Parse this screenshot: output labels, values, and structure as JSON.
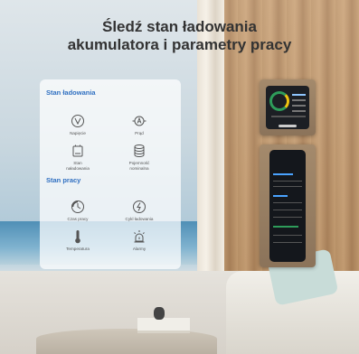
{
  "title": {
    "line1": "Śledź stan ładowania",
    "line2": "akumulatora i parametry pracy"
  },
  "charging_section": {
    "heading": "Stan ładowania",
    "items": [
      {
        "label": "Napięcie",
        "icon": "voltage-icon"
      },
      {
        "label": "Prąd",
        "icon": "current-icon"
      },
      {
        "label_line1": "Stan",
        "label_line2": "naładowania",
        "icon": "battery-icon"
      },
      {
        "label_line1": "Pojemność",
        "label_line2": "nominalna",
        "icon": "capacity-icon"
      }
    ]
  },
  "work_section": {
    "heading": "Stan pracy",
    "items": [
      {
        "label": "Czas pracy",
        "icon": "work-time-icon"
      },
      {
        "label": "Cykl ładowania",
        "icon": "charge-cycle-icon"
      },
      {
        "label": "Temperatura",
        "icon": "thermometer-icon"
      },
      {
        "label": "Alarmy",
        "icon": "alarm-icon"
      }
    ]
  },
  "colors": {
    "accent": "#2f6fc1",
    "icon_stroke": "#555555",
    "title": "#333333"
  }
}
